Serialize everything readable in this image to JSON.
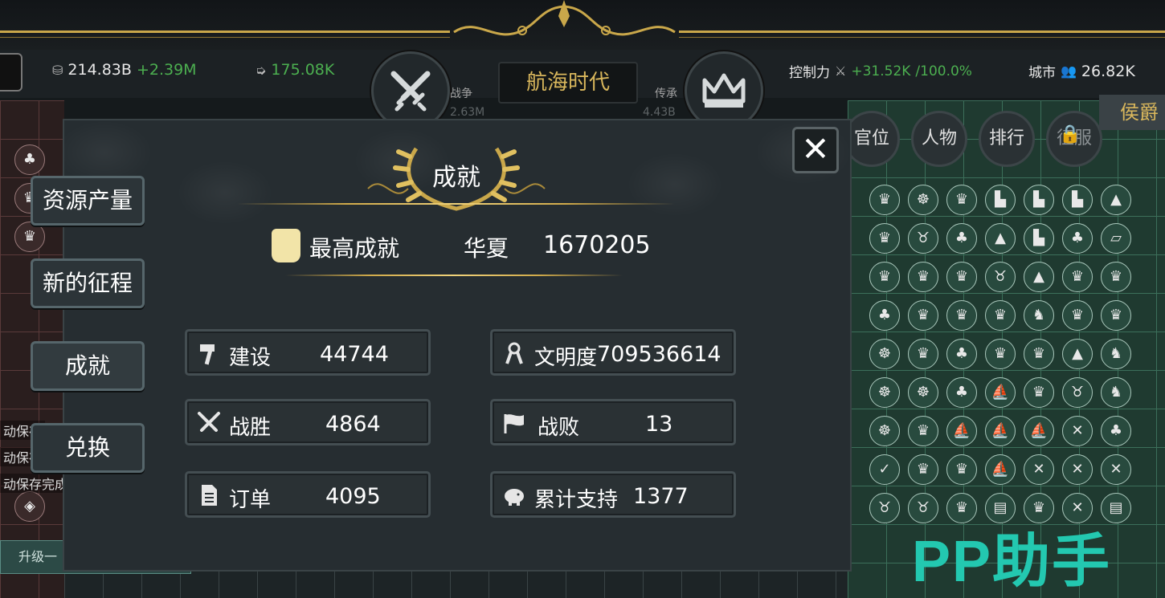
{
  "topbar": {
    "resources": [
      {
        "value": "214.83B",
        "delta": "+2.39M",
        "icon": "coins-icon"
      },
      {
        "value": "175.08K",
        "icon": "arrow-icon"
      }
    ],
    "era": "航海时代",
    "war_label": "战争",
    "war_value": "2.63M",
    "legacy_label": "传承",
    "legacy_value": "4.43B",
    "control_label": "控制力",
    "control_delta": "+31.52K",
    "control_percent": "/100.0%",
    "city_label": "城市",
    "city_value": "26.82K"
  },
  "right_menu": [
    {
      "label": "官位"
    },
    {
      "label": "人物"
    },
    {
      "label": "排行"
    },
    {
      "label": "征服",
      "locked": true
    }
  ],
  "rank_badge": "侯爵",
  "side_tabs": [
    {
      "label": "资源产量"
    },
    {
      "label": "新的征程"
    },
    {
      "label": "成就",
      "active": true
    },
    {
      "label": "兑换"
    }
  ],
  "modal": {
    "title": "成就",
    "best": {
      "label": "最高成就",
      "civ": "华夏",
      "score": "1670205"
    },
    "stats": [
      {
        "icon": "hammer-icon",
        "label": "建设",
        "value": "44744"
      },
      {
        "icon": "ribbon-icon",
        "label": "文明度",
        "value": "709536614"
      },
      {
        "icon": "crossed-swords-icon",
        "label": "战胜",
        "value": "4864"
      },
      {
        "icon": "flag-icon",
        "label": "战败",
        "value": "13"
      },
      {
        "icon": "document-icon",
        "label": "订单",
        "value": "4095"
      },
      {
        "icon": "piggy-bank-icon",
        "label": "累计支持",
        "value": "1377"
      }
    ]
  },
  "left_notices": [
    "动保存",
    "动保存",
    "动保存完成"
  ],
  "upgrade_button": "升级一",
  "watermark": "PP助手",
  "colors": {
    "accent_gold": "#d9b75c",
    "green_delta": "#4caf50",
    "panel_bg": "#262d31",
    "watermark": "#23c8b0"
  }
}
